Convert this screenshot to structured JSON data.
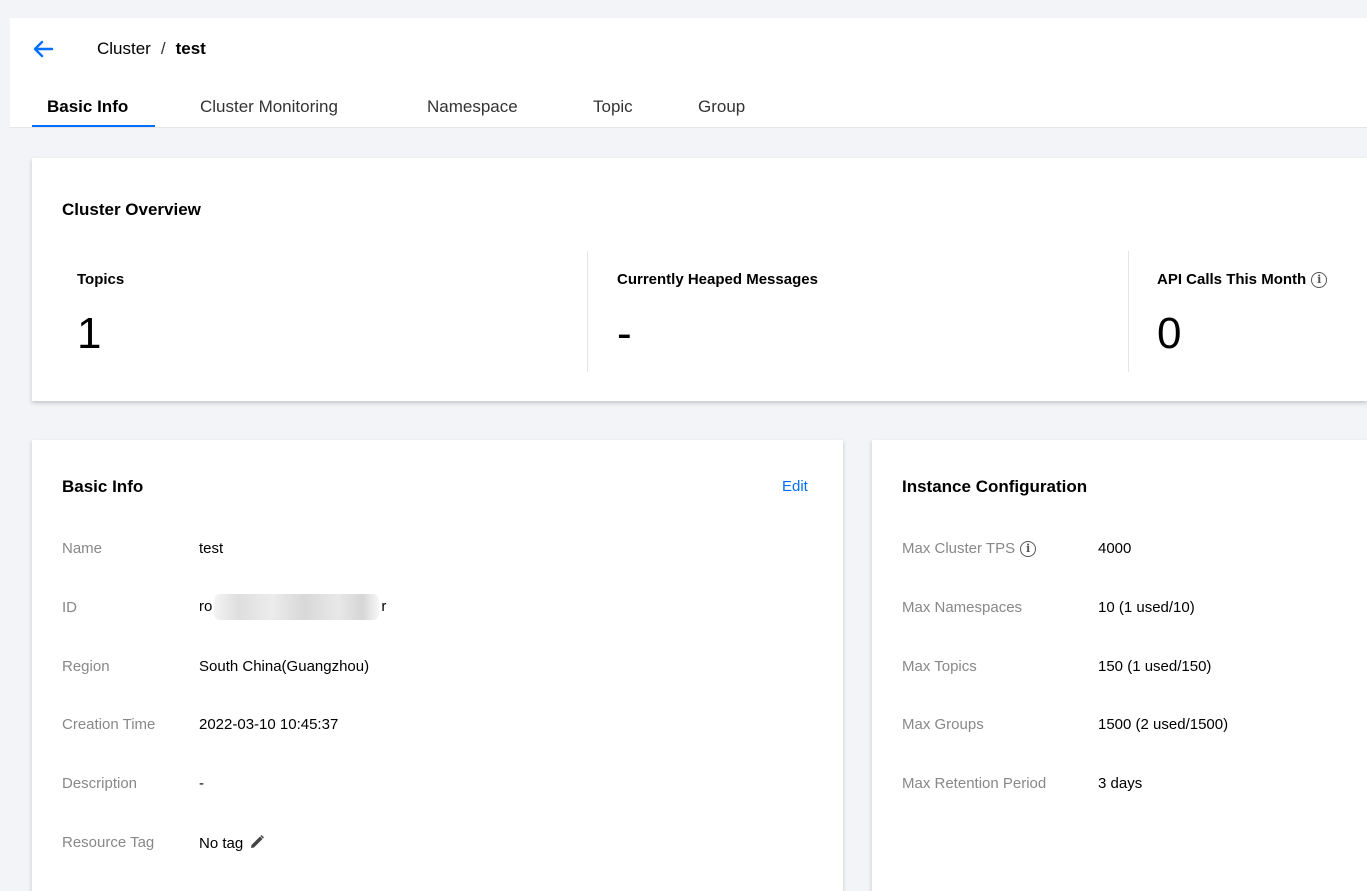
{
  "header": {
    "breadcrumb_parent": "Cluster",
    "breadcrumb_sep": "/",
    "breadcrumb_current": "test"
  },
  "tabs": [
    {
      "label": "Basic Info",
      "active": true
    },
    {
      "label": "Cluster Monitoring",
      "active": false
    },
    {
      "label": "Namespace",
      "active": false
    },
    {
      "label": "Topic",
      "active": false
    },
    {
      "label": "Group",
      "active": false
    }
  ],
  "overview": {
    "title": "Cluster Overview",
    "stats": [
      {
        "label": "Topics",
        "value": "1"
      },
      {
        "label": "Currently Heaped Messages",
        "value": "-"
      },
      {
        "label": "API Calls This Month",
        "value": "0",
        "info_icon": "info-icon"
      }
    ]
  },
  "basic_info": {
    "title": "Basic Info",
    "edit_label": "Edit",
    "rows": [
      {
        "label": "Name",
        "value": "test"
      },
      {
        "label": "ID",
        "value_prefix": "ro",
        "value_suffix": "r"
      },
      {
        "label": "Region",
        "value": "South China(Guangzhou)"
      },
      {
        "label": "Creation Time",
        "value": "2022-03-10 10:45:37"
      },
      {
        "label": "Description",
        "value": "-"
      },
      {
        "label": "Resource Tag",
        "value": "No tag",
        "icon": "pencil-icon"
      }
    ]
  },
  "instance_config": {
    "title": "Instance Configuration",
    "rows": [
      {
        "label": "Max Cluster TPS",
        "value": "4000",
        "info_icon": "info-icon"
      },
      {
        "label": "Max Namespaces",
        "value": "10 (1 used/10)"
      },
      {
        "label": "Max Topics",
        "value": "150 (1 used/150)"
      },
      {
        "label": "Max Groups",
        "value": "1500 (2 used/1500)"
      },
      {
        "label": "Max Retention Period",
        "value": "3 days"
      }
    ]
  },
  "colors": {
    "accent": "#006eff",
    "background": "#f3f4f7",
    "label_gray": "#888888"
  }
}
